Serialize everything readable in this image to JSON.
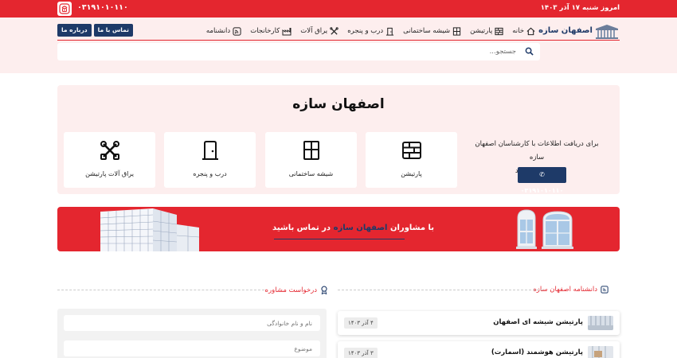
{
  "topbar": {
    "date": "امروز شنبه ۱۷ آذر ۱۴۰۳",
    "phone": "۰۳۱۹۱۰۱۰۱۱۰"
  },
  "header": {
    "brand": "اصفهان سازه",
    "nav": [
      {
        "label": "خانه",
        "icon": "home-icon"
      },
      {
        "label": "پارتیشن",
        "icon": "partition-icon"
      },
      {
        "label": "شیشه ساختمانی",
        "icon": "window-icon"
      },
      {
        "label": "درب و پنجره",
        "icon": "door-icon"
      },
      {
        "label": "یراق آلات",
        "icon": "tools-icon"
      },
      {
        "label": "کارخانجات",
        "icon": "factory-icon"
      },
      {
        "label": "دانشنامه",
        "icon": "rss-icon"
      }
    ],
    "about_label": "درباره ما",
    "contact_label": "تماس با ما"
  },
  "search": {
    "placeholder": "جستجو..."
  },
  "hero": {
    "title": "اصفهان سازه",
    "text_line1": "برای دریافت اطلاعات با کارشناسان اصفهان سازه",
    "text_line2": "در ارتباط باشید",
    "phone": "۰۳۱۹۱۰۱۰۱۱۰",
    "cards": [
      {
        "label": "پارتیشن",
        "icon": "partition-icon"
      },
      {
        "label": "شیشه ساختمانی",
        "icon": "window-icon"
      },
      {
        "label": "درب و پنجره",
        "icon": "door-icon"
      },
      {
        "label": "یراق آلات پارتیشن",
        "icon": "tools-icon"
      }
    ]
  },
  "banner": {
    "text_before": "با مشاوران",
    "text_highlight": "اصفهان سازه",
    "text_after": "در تماس باشید",
    "accent": "#1e3a68"
  },
  "sections": {
    "wiki_title": "دانشنامه اصفهان سازه",
    "consult_title": "درخواست مشاوره"
  },
  "form": {
    "name_placeholder": "نام و نام خانوادگی",
    "subject_placeholder": "موضوع"
  },
  "articles": [
    {
      "title": "پارتیشن شیشه ای اصفهان",
      "date": "۴ آذر ۱۴۰۳"
    },
    {
      "title": "پارتیشن هوشمند (اسمارت)",
      "date": "۳ آذر ۱۴۰۳"
    }
  ],
  "colors": {
    "primary_red": "#e4262f",
    "navy": "#1e3a68",
    "light_pink": "#fdeeee"
  }
}
